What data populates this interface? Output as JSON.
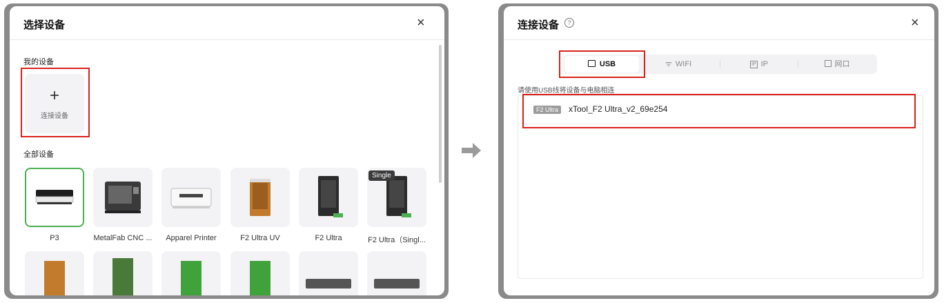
{
  "left_dialog": {
    "title": "选择设备",
    "close": "×",
    "my_devices_label": "我的设备",
    "connect_device_plus": "+",
    "connect_device_label": "连接设备",
    "all_devices_label": "全部设备",
    "single_tag": "Single",
    "devices": [
      {
        "name": "P3",
        "selected": true
      },
      {
        "name": "MetalFab CNC ...",
        "selected": false
      },
      {
        "name": "Apparel Printer",
        "selected": false
      },
      {
        "name": "F2 Ultra UV",
        "selected": false
      },
      {
        "name": "F2 Ultra",
        "selected": false
      },
      {
        "name": "F2 Ultra（Singl...",
        "selected": false
      }
    ]
  },
  "right_dialog": {
    "title": "连接设备",
    "help_icon": "?",
    "close": "×",
    "tabs": [
      {
        "label": "USB",
        "icon": "usb-icon",
        "active": true
      },
      {
        "label": "WIFI",
        "icon": "wifi-icon",
        "active": false
      },
      {
        "label": "IP",
        "icon": "ip-icon",
        "active": false
      },
      {
        "label": "网口",
        "icon": "ethernet-icon",
        "active": false
      }
    ],
    "hint": "请使用USB线将设备与电脑相连",
    "device_badge": "F2 Ultra",
    "device_name": "xTool_F2 Ultra_v2_69e254"
  },
  "colors": {
    "highlight": "#d9201a",
    "selected_border": "#4caf50"
  }
}
